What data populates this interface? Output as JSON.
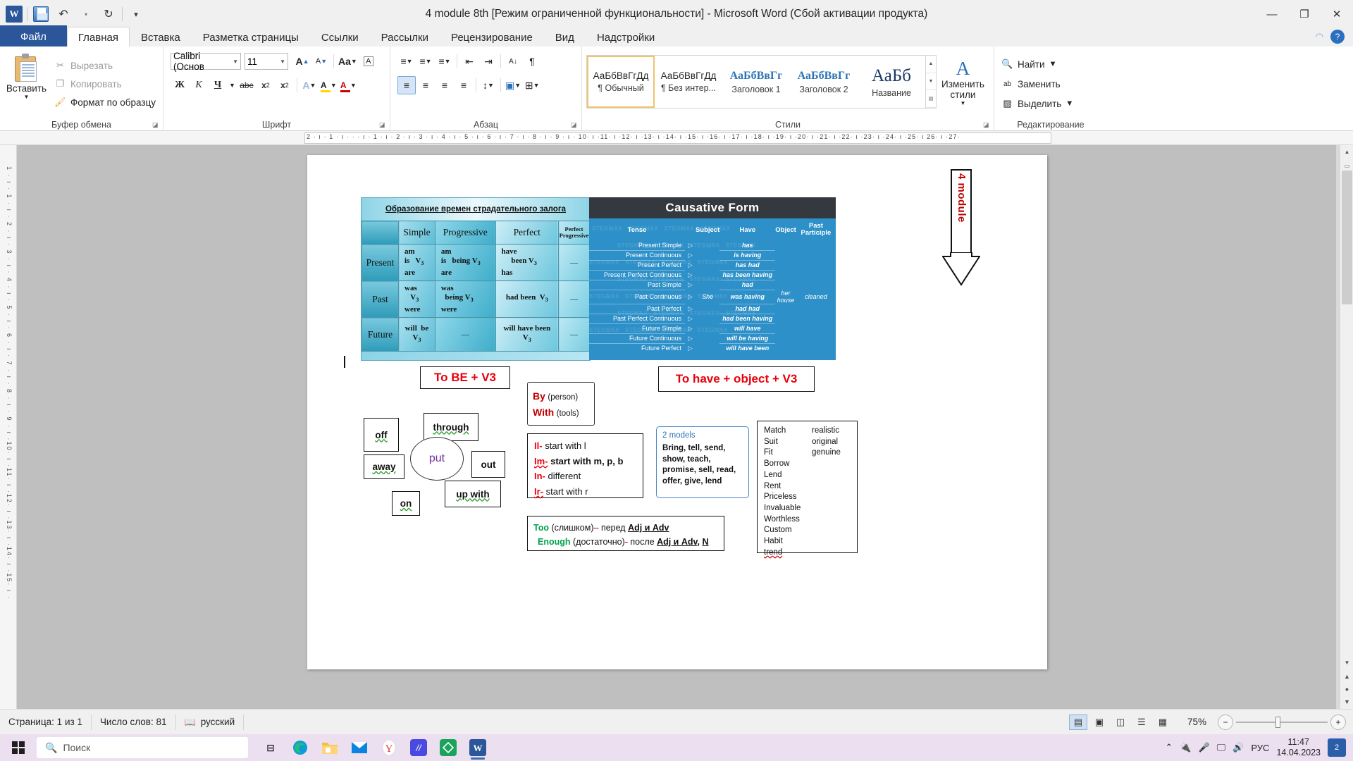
{
  "window": {
    "title": "4 module 8th [Режим ограниченной функциональности]  -  Microsoft Word (Сбой активации продукта)",
    "minimize": "—",
    "restore": "❐",
    "close": "✕"
  },
  "qat": {
    "word_logo": "W",
    "undo": "↶",
    "undo_dd": "▾",
    "redo": "↻",
    "more": "▾"
  },
  "tabs": [
    {
      "label": "Файл",
      "id": "file"
    },
    {
      "label": "Главная",
      "id": "home"
    },
    {
      "label": "Вставка",
      "id": "insert"
    },
    {
      "label": "Разметка страницы",
      "id": "layout"
    },
    {
      "label": "Ссылки",
      "id": "refs"
    },
    {
      "label": "Рассылки",
      "id": "mailings"
    },
    {
      "label": "Рецензирование",
      "id": "review"
    },
    {
      "label": "Вид",
      "id": "view"
    },
    {
      "label": "Надстройки",
      "id": "addins"
    }
  ],
  "ribbon": {
    "clipboard": {
      "group": "Буфер обмена",
      "paste": "Вставить",
      "cut": "Вырезать",
      "copy": "Копировать",
      "format_painter": "Формат по образцу"
    },
    "font": {
      "group": "Шрифт",
      "font_name": "Calibri (Основ",
      "font_size": "11",
      "grow": "A",
      "shrink": "A",
      "change_case": "Aa",
      "clear_format": "A",
      "bold": "Ж",
      "italic": "К",
      "underline": "Ч",
      "strike": "abc",
      "subscript": "x",
      "superscript": "x",
      "text_effects": "A",
      "highlight": "A",
      "font_color": "A"
    },
    "paragraph": {
      "group": "Абзац",
      "bullets": "≡",
      "numbering": "≡",
      "multilevel": "≡",
      "dec_indent": "⇤",
      "inc_indent": "⇥",
      "sort": "A↓",
      "marks": "¶",
      "align_left": "≡",
      "align_center": "≡",
      "align_right": "≡",
      "justify": "≡",
      "line_spacing": "↕",
      "shading": "▣",
      "borders": "⊞"
    },
    "styles": {
      "group": "Стили",
      "items": [
        {
          "preview": "АаБбВвГгДд",
          "name": "¶ Обычный",
          "selected": true
        },
        {
          "preview": "АаБбВвГгДд",
          "name": "¶ Без интер...",
          "selected": false
        },
        {
          "preview": "АаБбВвГг",
          "name": "Заголовок 1",
          "selected": false
        },
        {
          "preview": "АаБбВвГг",
          "name": "Заголовок 2",
          "selected": false
        },
        {
          "preview": "АаБб",
          "name": "Название",
          "selected": false
        }
      ],
      "change_styles": "Изменить стили"
    },
    "editing": {
      "group": "Редактирование",
      "find": "Найти",
      "replace": "Заменить",
      "select": "Выделить"
    }
  },
  "ruler": {
    "horizontal": "2 · ı · 1 · ı · · · ı · 1 · ı · 2 · ı · 3 · ı · 4 · ı · 5 · ı · 6 · ı · 7 · ı · 8 · ı · 9 · ı · 10· ı ·11· ı ·12· ı ·13· ı ·14· ı ·15· ı ·16· ı ·17· ı ·18· ı ·19· ı ·20· ı ·21· ı ·22· ı ·23· ı ·24· ı ·25· ı 26· ı ·27·",
    "vertical": "1 · ı · 1 · ı · 2 · ı · 3 · ı · 4 · ı · 5 · ı · 6 · ı · 7 · ı · 8 · ı · 9 · ı ·10· ı ·11· ı ·12· ı ·13· ı ·14· ı ·15· ı ·",
    "tab_selector": "L"
  },
  "document": {
    "passive_table": {
      "title": "Образование времен страдательного залога",
      "columns": [
        "",
        "Simple",
        "Progressive",
        "Perfect",
        "Perfect Progressive"
      ],
      "rows": [
        {
          "tense": "Present",
          "simple": [
            "am",
            "is   V3",
            "are"
          ],
          "progressive": [
            "am",
            "is    being V3",
            "are"
          ],
          "perfect": [
            "have",
            "been V3",
            "has"
          ],
          "perfect_progressive": "—"
        },
        {
          "tense": "Past",
          "simple": [
            "was",
            "V3",
            "were"
          ],
          "progressive": [
            "was",
            "being V3",
            "were"
          ],
          "perfect": [
            "had been  V3"
          ],
          "perfect_progressive": "—"
        },
        {
          "tense": "Future",
          "simple": [
            "will  be",
            "V3"
          ],
          "progressive": [
            "—"
          ],
          "perfect": [
            "will have been",
            "V3"
          ],
          "perfect_progressive": "—"
        }
      ]
    },
    "causative": {
      "title": "Causative Form",
      "columns": [
        "Tense",
        "Subject",
        "Have",
        "Object",
        "Past Participle"
      ],
      "subject": "She",
      "object": "her house",
      "past_participle": "cleaned",
      "watermark": "STEGMAX",
      "rows": [
        {
          "tense": "Present Simple",
          "have": "has"
        },
        {
          "tense": "Present Continuous",
          "have": "is having"
        },
        {
          "tense": "Present Perfect",
          "have": "has had"
        },
        {
          "tense": "Present Perfect Continuous",
          "have": "has been having"
        },
        {
          "tense": "Past Simple",
          "have": "had"
        },
        {
          "tense": "Past Continuous",
          "have": "was having"
        },
        {
          "tense": "Past Perfect",
          "have": "had had"
        },
        {
          "tense": "Past Perfect Continuous",
          "have": "had been having"
        },
        {
          "tense": "Future Simple",
          "have": "will have"
        },
        {
          "tense": "Future Continuous",
          "have": "will be having"
        },
        {
          "tense": "Future Perfect",
          "have": "will have been"
        }
      ]
    },
    "module_arrow": "4 module",
    "to_be_v3": "To BE + V3",
    "to_have": "To have + object + V3",
    "by_with": {
      "by_label": "By",
      "by_note": "(person)",
      "with_label": "With",
      "with_note": "(tools)"
    },
    "prefixes": [
      {
        "pref": "Il-",
        "text": "start with l"
      },
      {
        "pref": "Im-",
        "text": "start with m, p, b"
      },
      {
        "pref": "In-",
        "text": "different"
      },
      {
        "pref": "Ir-",
        "text": "start with r"
      }
    ],
    "models": {
      "title": "2 models",
      "body": "Bring, tell, send, show, teach, promise, sell, read, offer, give, lend"
    },
    "word_pairs": [
      {
        "a": "Match",
        "b": "realistic"
      },
      {
        "a": "Suit",
        "b": "original"
      },
      {
        "a": "Fit",
        "b": "genuine"
      },
      {
        "a": "Borrow",
        "b": ""
      },
      {
        "a": "Lend",
        "b": ""
      },
      {
        "a": "Rent",
        "b": ""
      },
      {
        "a": "Priceless",
        "b": ""
      },
      {
        "a": "Invaluable",
        "b": ""
      },
      {
        "a": "Worthless",
        "b": ""
      },
      {
        "a": "Custom",
        "b": ""
      },
      {
        "a": "Habit",
        "b": ""
      },
      {
        "a": "trend",
        "b": ""
      }
    ],
    "too_enough": {
      "too_word": "Too",
      "too_ru": "(слишком)",
      "too_dash": "–",
      "too_rest": "перед",
      "too_bold": "Adj и Adv",
      "enough_word": "Enough",
      "enough_ru": "(достаточно)",
      "enough_dash": "-",
      "enough_rest": "после",
      "enough_bold": "Adj и Adv,",
      "enough_tail": "N"
    },
    "phrasal": {
      "center": "put",
      "boxes": [
        "off",
        "through",
        "away",
        "out",
        "on",
        "up with"
      ]
    }
  },
  "status": {
    "page": "Страница: 1 из 1",
    "words": "Число слов: 81",
    "language": "русский",
    "zoom": "75%",
    "zoom_out": "−",
    "zoom_in": "+",
    "views": [
      "print-layout",
      "full-screen",
      "web-layout",
      "outline",
      "draft"
    ]
  },
  "taskbar": {
    "search_placeholder": "Поиск",
    "apps": [
      "task-view",
      "edge",
      "file-explorer",
      "mail",
      "yandex",
      "app-m",
      "app-green",
      "word"
    ],
    "tray": {
      "lang": "РУС",
      "time": "11:47",
      "date": "14.04.2023",
      "notif": "2"
    }
  }
}
